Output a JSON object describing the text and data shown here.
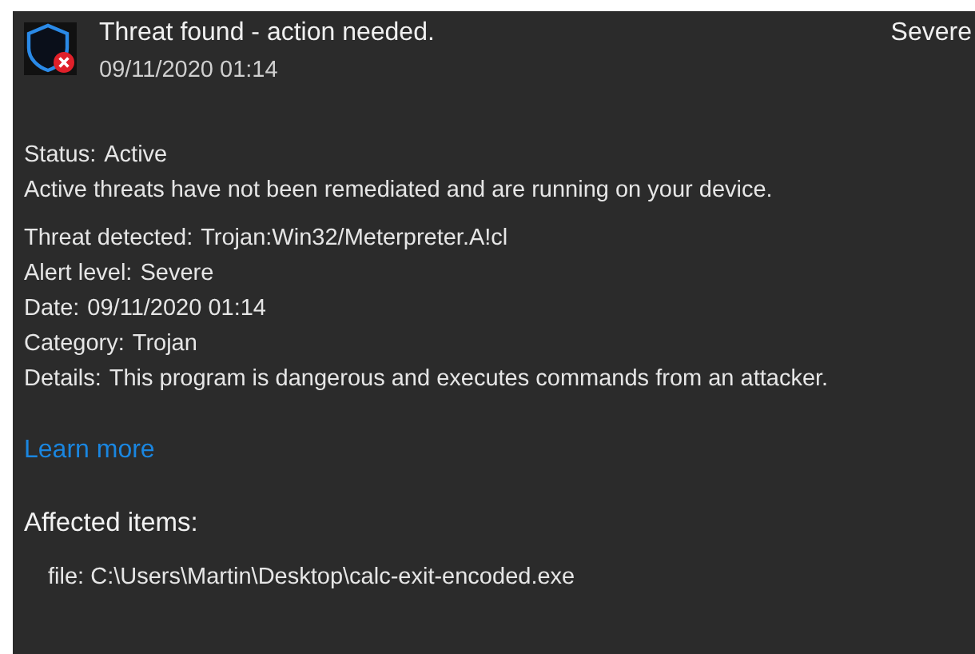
{
  "header": {
    "title": "Threat found - action needed.",
    "date": "09/11/2020 01:14",
    "severity": "Severe"
  },
  "status": {
    "label": "Status:",
    "value": "Active",
    "description": "Active threats have not been remediated and are running on your device."
  },
  "details": [
    {
      "label": "Threat detected:",
      "value": "Trojan:Win32/Meterpreter.A!cl"
    },
    {
      "label": "Alert level:",
      "value": "Severe"
    },
    {
      "label": "Date:",
      "value": "09/11/2020 01:14"
    },
    {
      "label": "Category:",
      "value": "Trojan"
    },
    {
      "label": "Details:",
      "value": "This program is dangerous and executes commands from an attacker."
    }
  ],
  "link": "Learn more",
  "affected": {
    "heading": "Affected items:",
    "items": [
      "file: C:\\Users\\Martin\\Desktop\\calc-exit-encoded.exe"
    ]
  }
}
